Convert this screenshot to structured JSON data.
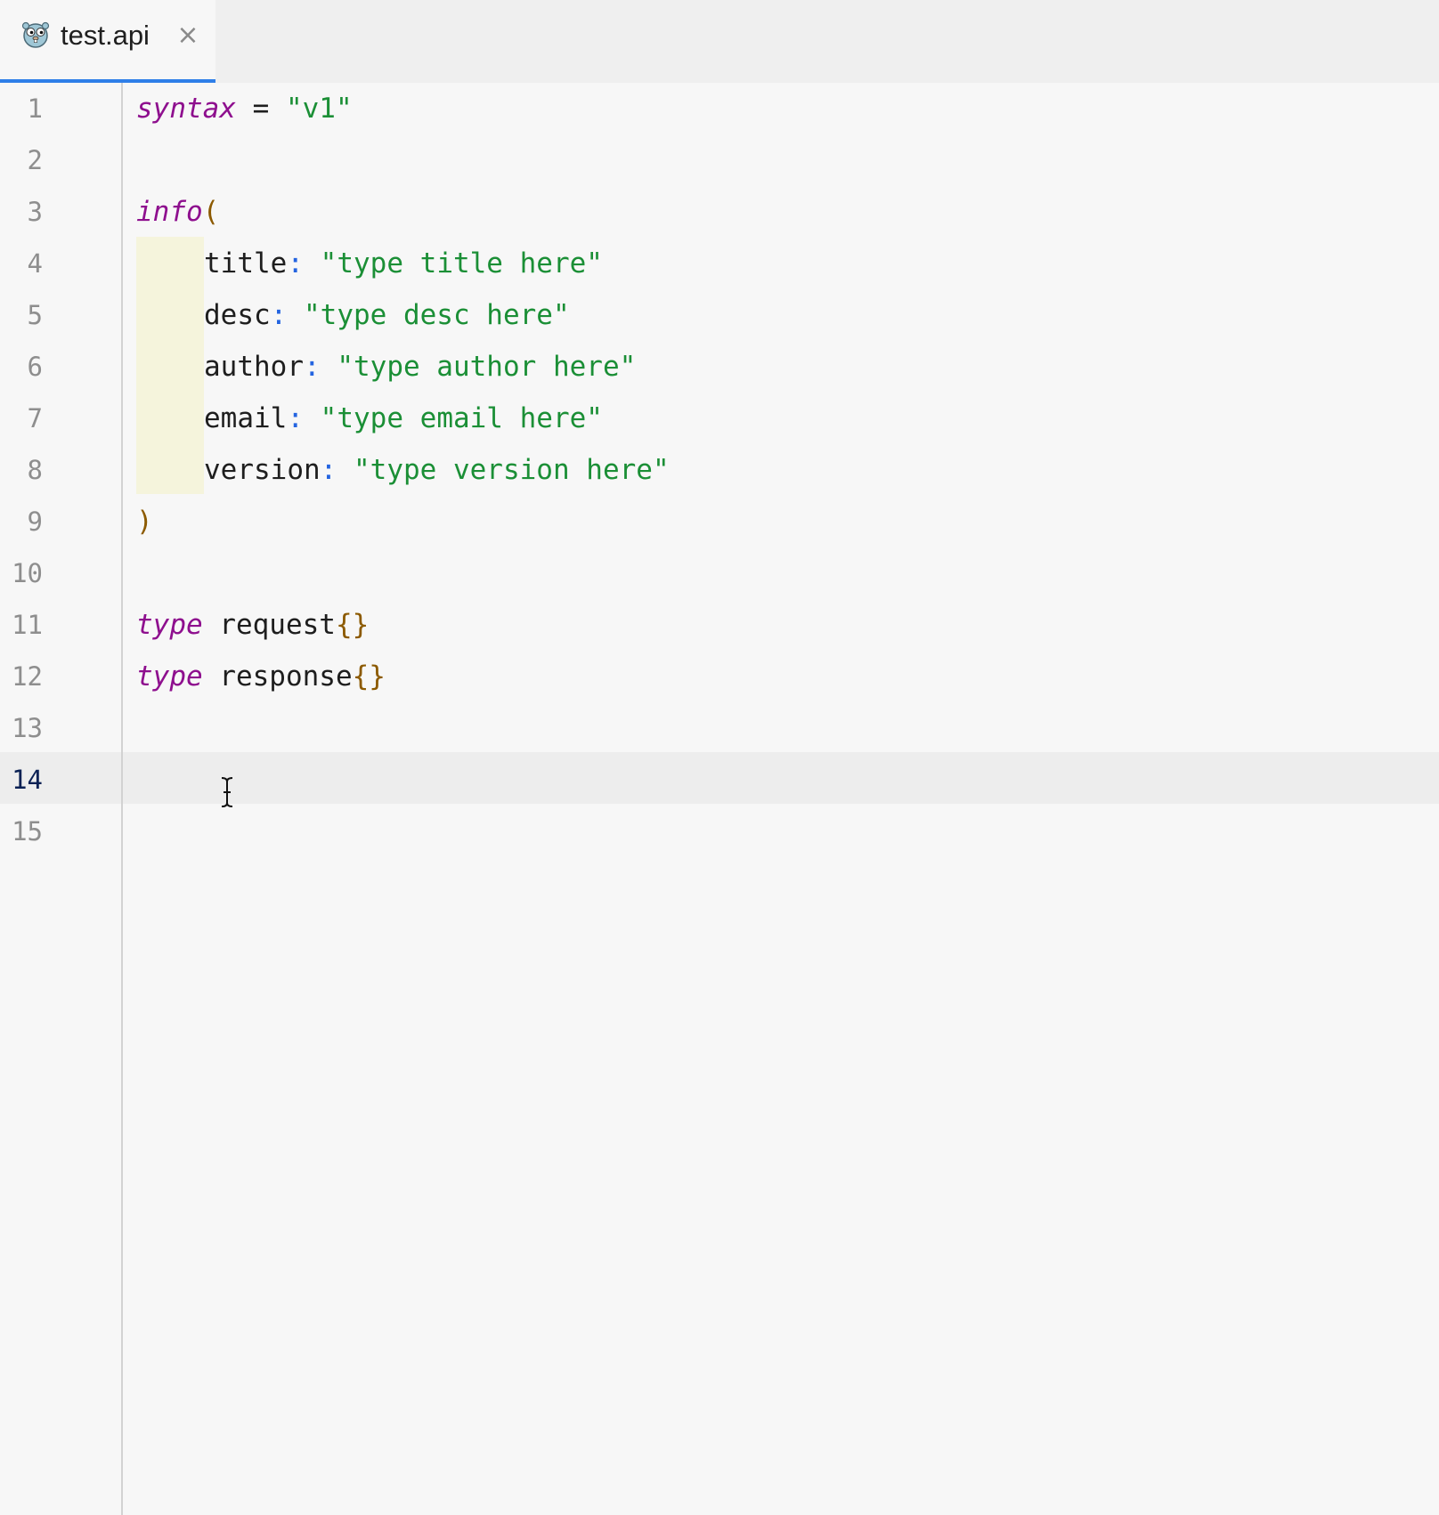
{
  "tab": {
    "filename": "test.api",
    "icon": "gopher-icon",
    "close_glyph": "×"
  },
  "line_numbers": [
    "1",
    "2",
    "3",
    "4",
    "5",
    "6",
    "7",
    "8",
    "9",
    "10",
    "11",
    "12",
    "13",
    "14",
    "15"
  ],
  "active_line": "14",
  "code": {
    "l1": {
      "kw": "syntax",
      "op": " = ",
      "str": "\"v1\""
    },
    "l3": {
      "kw": "info",
      "open": "("
    },
    "l4": {
      "key": "title",
      "colon": ":",
      "str": "\"type title here\""
    },
    "l5": {
      "key": "desc",
      "colon": ":",
      "str": "\"type desc here\""
    },
    "l6": {
      "key": "author",
      "colon": ":",
      "str": "\"type author here\""
    },
    "l7": {
      "key": "email",
      "colon": ":",
      "str": "\"type email here\""
    },
    "l8": {
      "key": "version",
      "colon": ":",
      "str": "\"type version here\""
    },
    "l9": {
      "close": ")"
    },
    "l11": {
      "kw": "type",
      "name": " request",
      "braces": "{}"
    },
    "l12": {
      "kw": "type",
      "name": " response",
      "braces": "{}"
    }
  },
  "colors": {
    "keyword": "#8e0f8e",
    "string": "#1b8f36",
    "paren": "#8c5a00",
    "colon": "#2464e0",
    "tab_underline": "#2f7fe8"
  }
}
